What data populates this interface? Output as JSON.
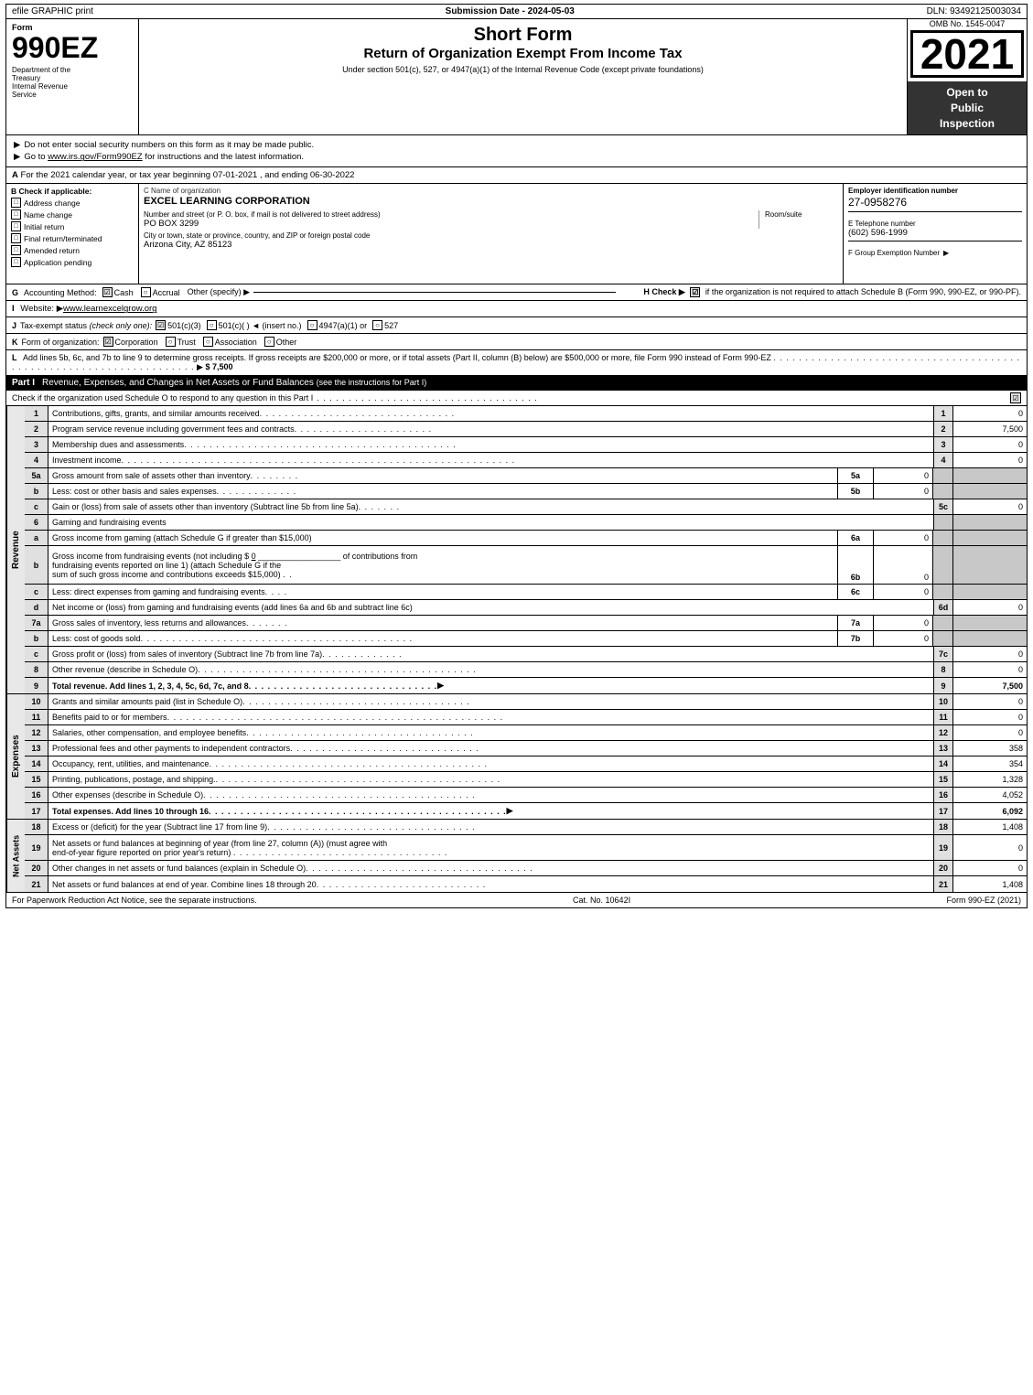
{
  "topbar": {
    "left": "efile GRAPHIC print",
    "center": "Submission Date - 2024-05-03",
    "right": "DLN: 93492125003034"
  },
  "form": {
    "number": "990EZ",
    "short_form_title": "Short Form",
    "return_title": "Return of Organization Exempt From Income Tax",
    "subtitle": "Under section 501(c), 527, or 4947(a)(1) of the Internal Revenue Code (except private foundations)",
    "instruction1": "Do not enter social security numbers on this form as it may be made public.",
    "instruction2": "Go to www.irs.gov/Form990EZ for instructions and the latest information.",
    "instruction2_url": "www.irs.gov/Form990EZ",
    "year": "2021",
    "omb": "OMB No. 1545-0047",
    "open_to_public": "Open to\nPublic\nInspection",
    "dept_line1": "Department of the",
    "dept_line2": "Treasury",
    "dept_line3": "Internal Revenue",
    "dept_line4": "Service"
  },
  "section_a": {
    "label": "A",
    "text": "For the 2021 calendar year, or tax year beginning 07-01-2021 , and ending 06-30-2022"
  },
  "section_b": {
    "label": "B",
    "title": "Check if applicable:",
    "options": [
      {
        "id": "address_change",
        "label": "Address change",
        "checked": false
      },
      {
        "id": "name_change",
        "label": "Name change",
        "checked": false
      },
      {
        "id": "initial_return",
        "label": "Initial return",
        "checked": false
      },
      {
        "id": "final_return",
        "label": "Final return/terminated",
        "checked": false
      },
      {
        "id": "amended_return",
        "label": "Amended return",
        "checked": false
      },
      {
        "id": "application_pending",
        "label": "Application pending",
        "checked": false
      }
    ]
  },
  "section_c": {
    "org_name_label": "C Name of organization",
    "org_name": "EXCEL LEARNING CORPORATION",
    "address_label": "Number and street (or P. O. box, if mail is not delivered to street address)",
    "address": "PO BOX 3299",
    "room_label": "Room/suite",
    "room": "",
    "city_label": "City or town, state or province, country, and ZIP or foreign postal code",
    "city": "Arizona City, AZ  85123"
  },
  "section_d": {
    "label": "D",
    "title": "Employer identification number",
    "ein": "27-0958276",
    "phone_label": "E Telephone number",
    "phone": "(602) 596-1999",
    "group_ex_label": "F Group Exemption Number",
    "group_ex_arrow": "▶",
    "group_ex": ""
  },
  "section_g": {
    "label": "G",
    "title": "Accounting Method:",
    "cash_label": "Cash",
    "cash_checked": true,
    "accrual_label": "Accrual",
    "accrual_checked": false,
    "other_label": "Other (specify) ▶",
    "other_line": "___________________________"
  },
  "section_h": {
    "label": "H",
    "text": "Check ▶",
    "checked": true,
    "description": "if the organization is not required to attach Schedule B (Form 990, 990-EZ, or 990-PF)."
  },
  "section_i": {
    "label": "I",
    "text": "Website: ▶www.learnexcelgrow.org"
  },
  "section_j": {
    "label": "J",
    "text": "Tax-exempt status",
    "check_only": "(check only one):",
    "options": [
      {
        "id": "501c3",
        "label": "501(c)(3)",
        "checked": true
      },
      {
        "id": "501c",
        "label": "501(c)(  )",
        "checked": false
      },
      {
        "id": "insert",
        "label": "◄ (insert no.)",
        "checked": false
      },
      {
        "id": "4947a1",
        "label": "4947(a)(1) or",
        "checked": false
      },
      {
        "id": "527",
        "label": "527",
        "checked": false
      }
    ]
  },
  "section_k": {
    "label": "K",
    "text": "Form of organization:",
    "options": [
      {
        "id": "corporation",
        "label": "Corporation",
        "checked": true
      },
      {
        "id": "trust",
        "label": "Trust",
        "checked": false
      },
      {
        "id": "association",
        "label": "Association",
        "checked": false
      },
      {
        "id": "other",
        "label": "Other",
        "checked": false
      }
    ]
  },
  "section_l": {
    "label": "L",
    "text": "Add lines 5b, 6c, and 7b to line 9 to determine gross receipts. If gross receipts are $200,000 or more, or if total assets (Part II, column (B) below) are $500,000 or more, file Form 990 instead of Form 990-EZ",
    "dots": ". . . . . . . . . . . . . . . . . . . . . . . . . . . . . . . . . . . . . . . . . . . . . . . . . . . . . . . . . .",
    "arrow": "▶",
    "value": "$ 7,500"
  },
  "part1": {
    "label": "Part I",
    "title": "Revenue, Expenses, and Changes in Net Assets or Fund Balances",
    "subtitle": "(see the instructions for Part I)",
    "check_text": "Check if the organization used Schedule O to respond to any question in this Part I",
    "check_dots": ". . . . . . . . . . . . . . . . . . . . . . . . . . . . . . . . .",
    "checked": true,
    "rows": [
      {
        "num": "1",
        "desc": "Contributions, gifts, grants, and similar amounts received",
        "dots": ". . . . . . . . . . . . . . . . . . . . . . . . . . . . . . . .",
        "col": "1",
        "value": "0"
      },
      {
        "num": "2",
        "desc": "Program service revenue including government fees and contracts",
        "dots": ". . . . . . . . . . . . . . . . . . . . . . .",
        "col": "2",
        "value": "7,500"
      },
      {
        "num": "3",
        "desc": "Membership dues and assessments",
        "dots": ". . . . . . . . . . . . . . . . . . . . . . . . . . . . . . . . . . . . . . . . . . .",
        "col": "3",
        "value": "0"
      },
      {
        "num": "4",
        "desc": "Investment income",
        "dots": ". . . . . . . . . . . . . . . . . . . . . . . . . . . . . . . . . . . . . . . . . . . . . . . . . . . . . . . . . . . . . . .",
        "col": "4",
        "value": "0"
      },
      {
        "num": "5a",
        "desc": "Gross amount from sale of assets other than inventory",
        "dots": ". . . . . . . .",
        "lineref": "5a",
        "lineval": "0",
        "col": "",
        "value": ""
      },
      {
        "num": "b",
        "desc": "Less: cost or other basis and sales expenses",
        "dots": ". . . . . . . . . . . . .",
        "lineref": "5b",
        "lineval": "0",
        "col": "",
        "value": ""
      },
      {
        "num": "c",
        "desc": "Gain or (loss) from sale of assets other than inventory (Subtract line 5b from line 5a)",
        "dots": ". . . . . . .",
        "col": "5c",
        "value": "0"
      },
      {
        "num": "6",
        "desc": "Gaming and fundraising events",
        "col": "",
        "value": ""
      },
      {
        "num": "a",
        "desc": "Gross income from gaming (attach Schedule G if greater than $15,000)",
        "lineref": "6a",
        "lineval": "0",
        "col": "",
        "value": ""
      },
      {
        "num": "b",
        "desc_multiline": true,
        "desc": "Gross income from fundraising events (not including $ 0 ________________ of contributions from fundraising events reported on line 1) (attach Schedule G if the sum of such gross income and contributions exceeds $15,000)",
        "dots": ". .",
        "lineref": "6b",
        "lineval": "0",
        "col": "",
        "value": ""
      },
      {
        "num": "c",
        "desc": "Less: direct expenses from gaming and fundraising events",
        "dots": ". . . .",
        "lineref": "6c",
        "lineval": "0",
        "col": "",
        "value": ""
      },
      {
        "num": "d",
        "desc": "Net income or (loss) from gaming and fundraising events (add lines 6a and 6b and subtract line 6c)",
        "col": "6d",
        "value": "0"
      },
      {
        "num": "7a",
        "desc": "Gross sales of inventory, less returns and allowances",
        "dots": ". . . . . . .",
        "lineref": "7a",
        "lineval": "0",
        "col": "",
        "value": ""
      },
      {
        "num": "b",
        "desc": "Less: cost of goods sold",
        "dots": ". . . . . . . . . . . . . . . . . . . . . . . . . . . . . . . . . . . . . .",
        "lineref": "7b",
        "lineval": "0",
        "col": "",
        "value": ""
      },
      {
        "num": "c",
        "desc": "Gross profit or (loss) from sales of inventory (Subtract line 7b from line 7a)",
        "dots": ". . . . . . . . . . . . .",
        "col": "7c",
        "value": "0"
      },
      {
        "num": "8",
        "desc": "Other revenue (describe in Schedule O)",
        "dots": ". . . . . . . . . . . . . . . . . . . . . . . . . . . . . . . . . . . . . . . . . . . . . .",
        "col": "8",
        "value": "0"
      },
      {
        "num": "9",
        "desc": "Total revenue. Add lines 1, 2, 3, 4, 5c, 6d, 7c, and 8",
        "dots": ". . . . . . . . . . . . . . . . . . . . . . . . . . . . . . . . .",
        "arrow": "▶",
        "col": "9",
        "value": "7,500",
        "bold": true
      }
    ]
  },
  "part1_expenses": {
    "rows": [
      {
        "num": "10",
        "desc": "Grants and similar amounts paid (list in Schedule O)",
        "dots": ". . . . . . . . . . . . . . . . . . . . . . . . . . . . . . . . . . . . .",
        "col": "10",
        "value": "0"
      },
      {
        "num": "11",
        "desc": "Benefits paid to or for members",
        "dots": ". . . . . . . . . . . . . . . . . . . . . . . . . . . . . . . . . . . . . . . . . . . . . . . . . . . . . .",
        "col": "11",
        "value": "0"
      },
      {
        "num": "12",
        "desc": "Salaries, other compensation, and employee benefits",
        "dots": ". . . . . . . . . . . . . . . . . . . . . . . . . . . . . . . . . . . . . .",
        "col": "12",
        "value": "0"
      },
      {
        "num": "13",
        "desc": "Professional fees and other payments to independent contractors",
        "dots": ". . . . . . . . . . . . . . . . . . . . . . . . . . . . . . .",
        "col": "13",
        "value": "358"
      },
      {
        "num": "14",
        "desc": "Occupancy, rent, utilities, and maintenance",
        "dots": ". . . . . . . . . . . . . . . . . . . . . . . . . . . . . . . . . . . . . . . . . . . . . . .",
        "col": "14",
        "value": "354"
      },
      {
        "num": "15",
        "desc": "Printing, publications, postage, and shipping.",
        "dots": ". . . . . . . . . . . . . . . . . . . . . . . . . . . . . . . . . . . . . . . . . . . . .",
        "col": "15",
        "value": "1,328"
      },
      {
        "num": "16",
        "desc": "Other expenses (describe in Schedule O)",
        "dots": ". . . . . . . . . . . . . . . . . . . . . . . . . . . . . . . . . . . . . . . . . . . . .",
        "col": "16",
        "value": "4,052"
      },
      {
        "num": "17",
        "desc": "Total expenses. Add lines 10 through 16",
        "dots": ". . . . . . . . . . . . . . . . . . . . . . . . . . . . . . . . . . . . . . . . . . . . . . .",
        "arrow": "▶",
        "col": "17",
        "value": "6,092",
        "bold": true
      }
    ]
  },
  "part1_net_assets": {
    "rows": [
      {
        "num": "18",
        "desc": "Excess or (deficit) for the year (Subtract line 17 from line 9)",
        "dots": ". . . . . . . . . . . . . . . . . . . . . . . . . . . . . . . . . . .",
        "col": "18",
        "value": "1,408"
      },
      {
        "num": "19",
        "desc": "Net assets or fund balances at beginning of year (from line 27, column (A)) (must agree with end-of-year figure reported on prior year's return)",
        "dots": ". . . . . . . . . . . . . . . . . . . . . . . . . . . . . . . . . .",
        "col": "19",
        "value": "0"
      },
      {
        "num": "20",
        "desc": "Other changes in net assets or fund balances (explain in Schedule O)",
        "dots": ". . . . . . . . . . . . . . . . . . . . . . . . . . . . . . . . . . . . . . . . .",
        "col": "20",
        "value": "0"
      },
      {
        "num": "21",
        "desc": "Net assets or fund balances at end of year. Combine lines 18 through 20",
        "dots": ". . . . . . . . . . . . . . . . . . . . . . . . . . . .",
        "col": "21",
        "value": "1,408"
      }
    ]
  },
  "footer": {
    "left": "For Paperwork Reduction Act Notice, see the separate instructions.",
    "center": "Cat. No. 10642I",
    "right": "Form 990-EZ (2021)"
  }
}
